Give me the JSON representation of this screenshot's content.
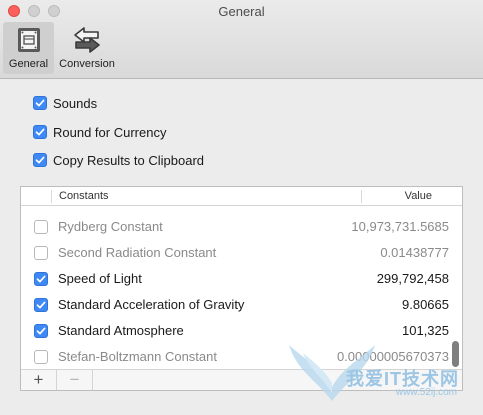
{
  "window": {
    "title": "General"
  },
  "toolbar": {
    "items": [
      {
        "label": "General",
        "icon": "general-prefs-icon",
        "selected": true
      },
      {
        "label": "Conversion",
        "icon": "conversion-arrows-icon",
        "selected": false
      }
    ]
  },
  "options": [
    {
      "label": "Sounds",
      "checked": true
    },
    {
      "label": "Round for Currency",
      "checked": true
    },
    {
      "label": "Copy Results to Clipboard",
      "checked": true
    }
  ],
  "table": {
    "columns": {
      "constants": "Constants",
      "value": "Value"
    },
    "rows": [
      {
        "name": "Rydberg Constant",
        "value": "10,973,731.5685",
        "checked": false
      },
      {
        "name": "Second Radiation Constant",
        "value": "0.01438777",
        "checked": false
      },
      {
        "name": "Speed of Light",
        "value": "299,792,458",
        "checked": true
      },
      {
        "name": "Standard Acceleration of Gravity",
        "value": "9.80665",
        "checked": true
      },
      {
        "name": "Standard Atmosphere",
        "value": "101,325",
        "checked": true
      },
      {
        "name": "Stefan-Boltzmann Constant",
        "value": "0.00000005670373",
        "checked": false
      }
    ],
    "footer": {
      "add_label": "+",
      "remove_label": "−"
    }
  },
  "watermark": {
    "text": "我爱IT技术网",
    "url": "www.52ij.com"
  },
  "colors": {
    "accent": "#3e89f5",
    "close": "#fc605c"
  }
}
